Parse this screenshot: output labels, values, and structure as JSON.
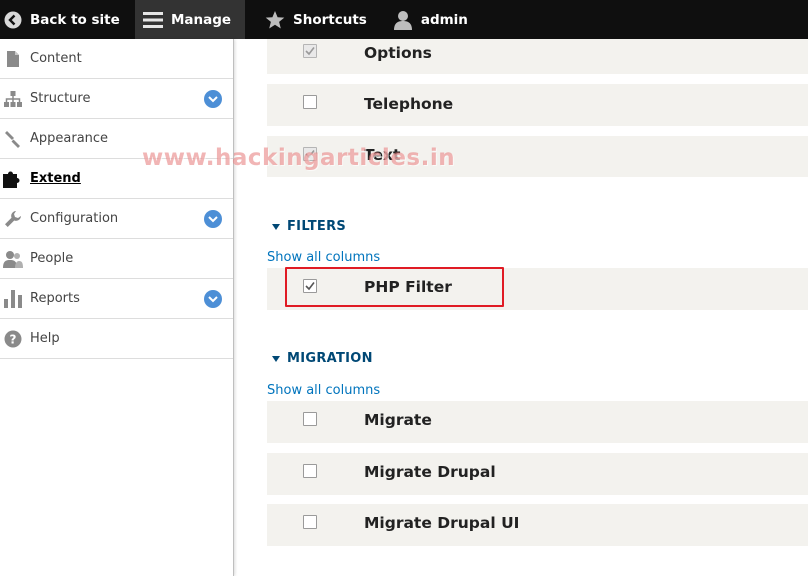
{
  "toolbar": {
    "back": "Back to site",
    "manage": "Manage",
    "shortcuts": "Shortcuts",
    "user": "admin"
  },
  "sidebar": {
    "items": [
      {
        "label": "Content",
        "icon": "file-icon",
        "chevron": false,
        "active": false
      },
      {
        "label": "Structure",
        "icon": "sitemap-icon",
        "chevron": true,
        "active": false
      },
      {
        "label": "Appearance",
        "icon": "paintbrush-icon",
        "chevron": false,
        "active": false
      },
      {
        "label": "Extend",
        "icon": "puzzle-icon",
        "chevron": false,
        "active": true
      },
      {
        "label": "Configuration",
        "icon": "wrench-icon",
        "chevron": true,
        "active": false
      },
      {
        "label": "People",
        "icon": "people-icon",
        "chevron": false,
        "active": false
      },
      {
        "label": "Reports",
        "icon": "bar-chart-icon",
        "chevron": true,
        "active": false
      },
      {
        "label": "Help",
        "icon": "help-icon",
        "chevron": false,
        "active": false
      }
    ]
  },
  "top_modules": [
    {
      "name": "Options",
      "checked": true,
      "disabled": true
    },
    {
      "name": "Telephone",
      "checked": false,
      "disabled": false
    },
    {
      "name": "Text",
      "checked": true,
      "disabled": true
    }
  ],
  "filters": {
    "heading": "FILTERS",
    "show_all": "Show all columns",
    "modules": [
      {
        "name": "PHP Filter",
        "checked": true,
        "disabled": false
      }
    ]
  },
  "migration": {
    "heading": "MIGRATION",
    "show_all": "Show all columns",
    "modules": [
      {
        "name": "Migrate",
        "checked": false,
        "disabled": false
      },
      {
        "name": "Migrate Drupal",
        "checked": false,
        "disabled": false
      },
      {
        "name": "Migrate Drupal UI",
        "checked": false,
        "disabled": false
      }
    ]
  },
  "watermark": "www.hackingarticles.in",
  "colors": {
    "accent": "#004875",
    "link": "#0074bd",
    "highlight": "#e01b24",
    "row_bg": "#f3f2ee"
  }
}
